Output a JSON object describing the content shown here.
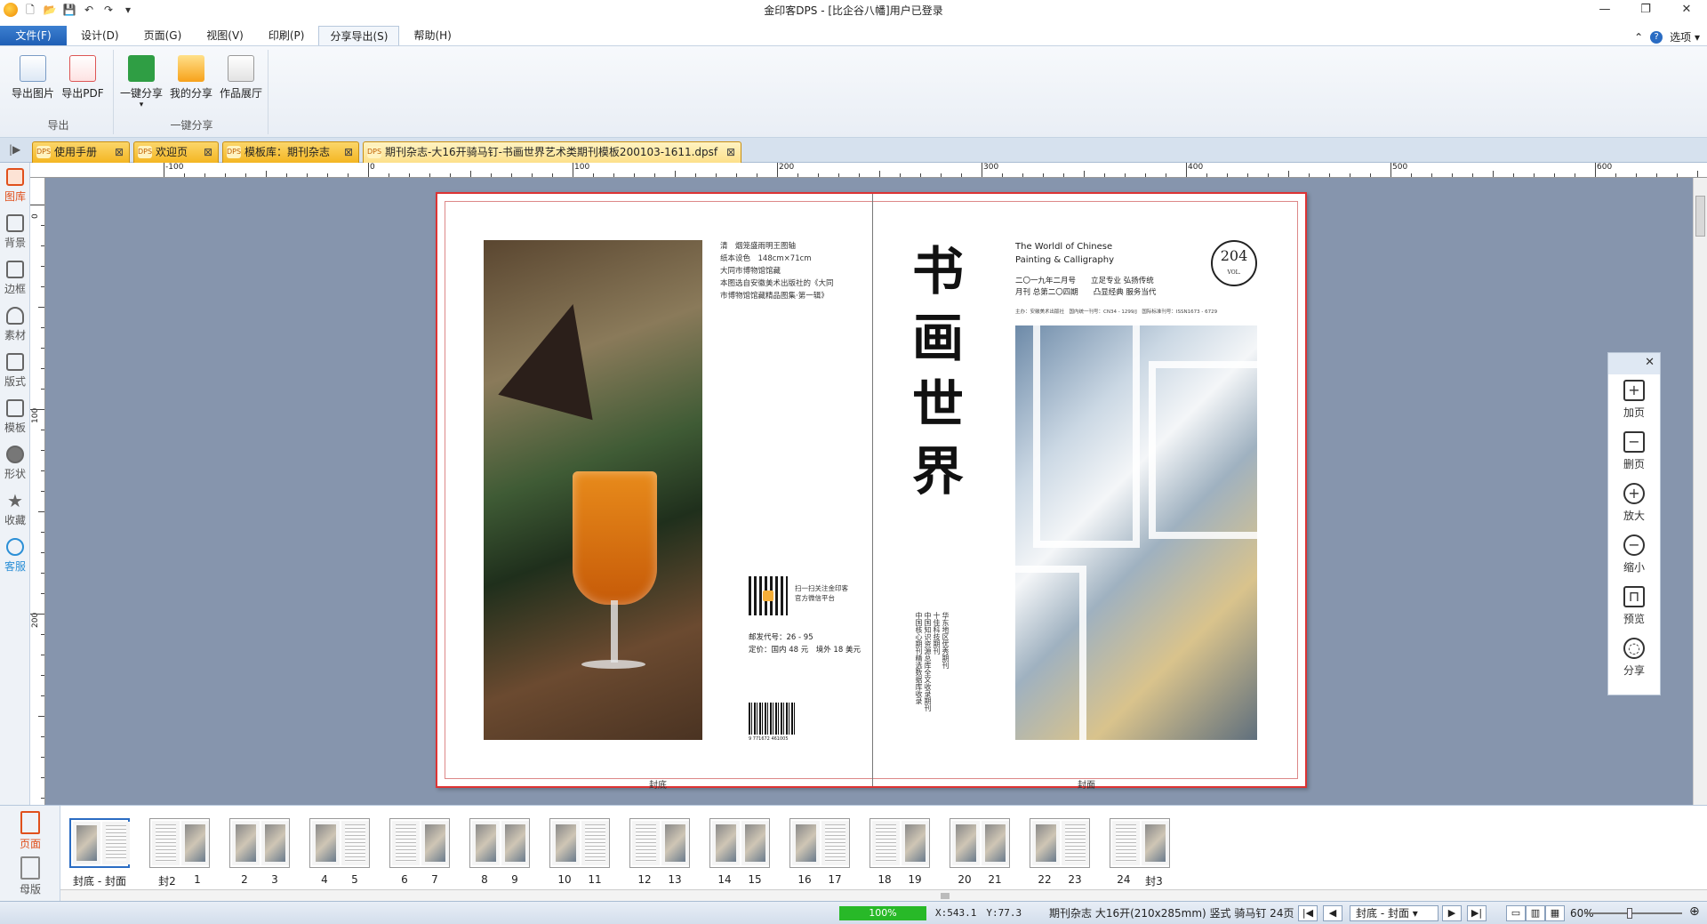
{
  "window": {
    "title": "金印客DPS - [比企谷八幡]用户已登录",
    "controls": [
      "—",
      "❐",
      "✕"
    ]
  },
  "quick_access": [
    "🗋",
    "📂",
    "💾",
    "↶",
    "↷",
    "▾"
  ],
  "menu": {
    "tabs": [
      "文件(F)",
      "设计(D)",
      "页面(G)",
      "视图(V)",
      "印刷(P)",
      "分享导出(S)",
      "帮助(H)"
    ],
    "active_index": 5,
    "right": {
      "collapse": "⌃",
      "help": "?",
      "options": "选项 ▾"
    }
  },
  "ribbon": {
    "groups": [
      {
        "label": "导出",
        "buttons": [
          "导出图片",
          "导出PDF"
        ]
      },
      {
        "label": "一键分享",
        "buttons": [
          "一键分享",
          "我的分享",
          "作品展厅"
        ]
      }
    ],
    "share_dropdown": "▾"
  },
  "doc_tabs": [
    {
      "label": "使用手册",
      "close": "⊠"
    },
    {
      "label": "欢迎页",
      "close": "⊠"
    },
    {
      "label": "模板库：期刊杂志",
      "close": "⊠"
    },
    {
      "label": "期刊杂志-大16开骑马钉-书画世界艺术类期刊模板200103-1611.dpsf",
      "close": "⊠",
      "active": true
    }
  ],
  "doc_tab_badge": "DPS",
  "sidebar": {
    "items": [
      "图库",
      "背景",
      "边框",
      "素材",
      "版式",
      "模板",
      "形状",
      "收藏",
      "客服"
    ],
    "active_index": 0
  },
  "ruler": {
    "h_labels": [
      "-100",
      "0",
      "100",
      "200",
      "300",
      "400",
      "500",
      "600"
    ],
    "v_labels": [
      "0",
      "100",
      "200"
    ]
  },
  "spread": {
    "left_label": "封底",
    "right_label": "封面",
    "back_text": [
      "清　烟笼盛雨明王图轴",
      "纸本设色　148cm×71cm",
      "大同市博物馆馆藏",
      "本图选自安徽美术出版社的《大同",
      "市博物馆馆藏精品图集·第一辑》"
    ],
    "qr_text": [
      "扫一扫关注金印客",
      "官方微信平台"
    ],
    "price_text": [
      "邮发代号：26 - 95",
      "定价：国内 48 元　境外 18 美元"
    ],
    "barcode_number": "9 771672 461005",
    "calligraphy": [
      "书",
      "画",
      "世",
      "界"
    ],
    "vertical_text": [
      "华东地区优秀期刊",
      "十佳科技期刊",
      "中国知识资源总库全文收录期刊",
      "中国核心期刊精选数据库收录"
    ],
    "mag_title": [
      "The Worldl of Chinese",
      "Painting & Calligraphy"
    ],
    "mag_info": [
      "二〇一九年二月号　　立足专业 弘扬传统",
      "月刊 总第二〇四期　　凸显经典 服务当代"
    ],
    "mag_small": "主办：安徽美术出版社　国内统一刊号：CN34 - 1299/J　国际标准刊号：ISSN1673 - 6729",
    "issue_number": "204",
    "issue_vol": "VOL."
  },
  "float_toolbar": {
    "close": "✕",
    "items": [
      {
        "label": "加页",
        "icon": "add-page-icon",
        "glyph": "+"
      },
      {
        "label": "删页",
        "icon": "delete-page-icon",
        "glyph": "−"
      },
      {
        "label": "放大",
        "icon": "zoom-in-icon",
        "glyph": "+"
      },
      {
        "label": "缩小",
        "icon": "zoom-out-icon",
        "glyph": "−"
      },
      {
        "label": "预览",
        "icon": "book-icon",
        "glyph": "⊓"
      },
      {
        "label": "分享",
        "icon": "wechat-icon",
        "glyph": "◌"
      }
    ]
  },
  "thumb_side": {
    "items": [
      "页面",
      "母版"
    ],
    "active_index": 0
  },
  "thumbnails": [
    {
      "labels": [
        "封底",
        "-",
        "封面"
      ],
      "active": true
    },
    {
      "labels": [
        "封2",
        "1"
      ]
    },
    {
      "labels": [
        "2",
        "3"
      ]
    },
    {
      "labels": [
        "4",
        "5"
      ]
    },
    {
      "labels": [
        "6",
        "7"
      ]
    },
    {
      "labels": [
        "8",
        "9"
      ]
    },
    {
      "labels": [
        "10",
        "11"
      ]
    },
    {
      "labels": [
        "12",
        "13"
      ]
    },
    {
      "labels": [
        "14",
        "15"
      ]
    },
    {
      "labels": [
        "16",
        "17"
      ]
    },
    {
      "labels": [
        "18",
        "19"
      ]
    },
    {
      "labels": [
        "20",
        "21"
      ]
    },
    {
      "labels": [
        "22",
        "23"
      ]
    },
    {
      "labels": [
        "24",
        "封3"
      ]
    }
  ],
  "status": {
    "progress_value": 100,
    "progress_text": "100%",
    "coords": "X:543.1　Y:77.3",
    "doc_info": "期刊杂志 大16开(210x285mm) 竖式 骑马钉 24页",
    "nav": [
      "|◀",
      "◀",
      "▶",
      "▶|"
    ],
    "page_select": "封底 - 封面 ▾",
    "view_icons": [
      "▭",
      "▥",
      "▦"
    ],
    "zoom": "60%",
    "zoom_minus": "⊖",
    "zoom_plus": "⊕",
    "zoom_fraction": 0.6
  }
}
